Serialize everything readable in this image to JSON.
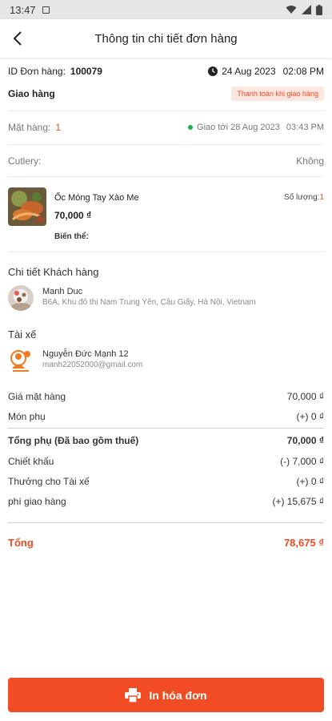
{
  "status_bar": {
    "time": "13:47"
  },
  "header": {
    "title": "Thông tin chi tiết đơn hàng"
  },
  "order": {
    "id_label": "ID Đơn hàng:",
    "id_value": "100079",
    "date": "24 Aug 2023",
    "time": "02:08 PM",
    "delivery_type": "Giao hàng",
    "payment_badge": "Thanh toán khi giao hàng",
    "items_label": "Mặt hàng:",
    "items_count": "1",
    "delivered_to_label": "Giao tới 28 Aug 2023",
    "delivered_time": "03:43 PM",
    "cutlery_label": "Cutlery:",
    "cutlery_value": "Không"
  },
  "product": {
    "name": "Ốc Móng Tay Xào Me",
    "price": "70,000 ₫",
    "variant_label": "Biến thể:",
    "qty_label": "Số lượng:",
    "qty_value": "1"
  },
  "customer": {
    "section_title": "Chi tiết Khách hàng",
    "name": "Manh Duc",
    "address": "B6A, Khu đô thị Nam Trung Yên, Cầu Giấy, Hà Nội, Vietnam"
  },
  "driver": {
    "section_title": "Tài xế",
    "name": "Nguyễn Đức Mạnh 12",
    "email": "manh22052000@gmail.com"
  },
  "summary": {
    "item_price_label": "Giá mặt hàng",
    "item_price_value": "70,000 ₫",
    "addon_label": "Món phụ",
    "addon_value": "(+) 0 ₫",
    "subtotal_label": "Tổng phụ (Đã bao gồm thuế)",
    "subtotal_value": "70,000 ₫",
    "discount_label": "Chiết khấu",
    "discount_value": "(-) 7,000 ₫",
    "tip_label": "Thưởng cho Tài xế",
    "tip_value": "(+) 0 ₫",
    "delivery_fee_label": "phí giao hàng",
    "delivery_fee_value": "(+) 15,675 ₫",
    "total_label": "Tổng",
    "total_value": "78,675 ₫"
  },
  "actions": {
    "print_label": "In hóa đơn"
  },
  "colors": {
    "accent": "#f24c24",
    "green": "#1fb141"
  }
}
